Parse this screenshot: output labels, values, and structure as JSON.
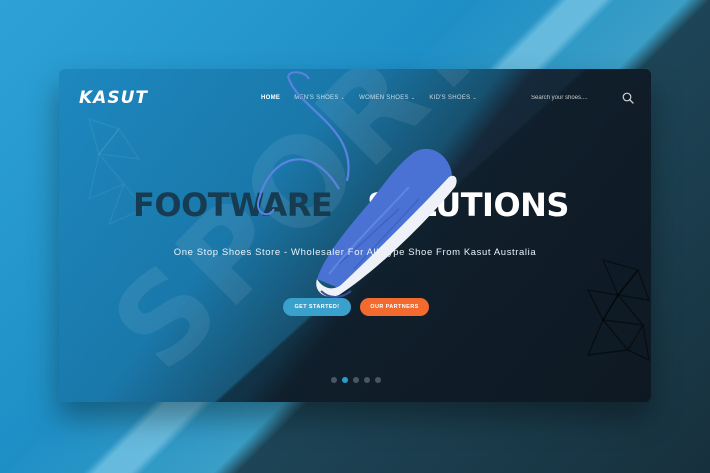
{
  "brand": {
    "logo_text": "KASUT"
  },
  "nav": {
    "items": [
      {
        "label": "HOME",
        "active": true,
        "dropdown": false
      },
      {
        "label": "MEN'S SHOES",
        "active": false,
        "dropdown": true
      },
      {
        "label": "WOMEN SHOES",
        "active": false,
        "dropdown": true
      },
      {
        "label": "KID'S SHOES",
        "active": false,
        "dropdown": true
      }
    ],
    "chevron": "⌄"
  },
  "search": {
    "placeholder": "Search your shoes....",
    "icon": "search-icon"
  },
  "hero": {
    "headline_left": "FOOTWARE",
    "headline_right": "SOLUTIONS",
    "subtitle": "One Stop Shoes Store - Wholesaler For All Type Shoe From Kasut Australia",
    "watermark": "SPORT",
    "primary_button": "GET STARTED!",
    "secondary_button": "OUR PARTNERS"
  },
  "slider": {
    "count": 5,
    "active_index": 1
  },
  "colors": {
    "primary_blue": "#2b9bd0",
    "button_blue": "#3aa0cc",
    "button_orange": "#f26a2e",
    "dark_navy": "#111c27",
    "headline_dark": "#173c52",
    "shoe_blue": "#4a72d4"
  }
}
